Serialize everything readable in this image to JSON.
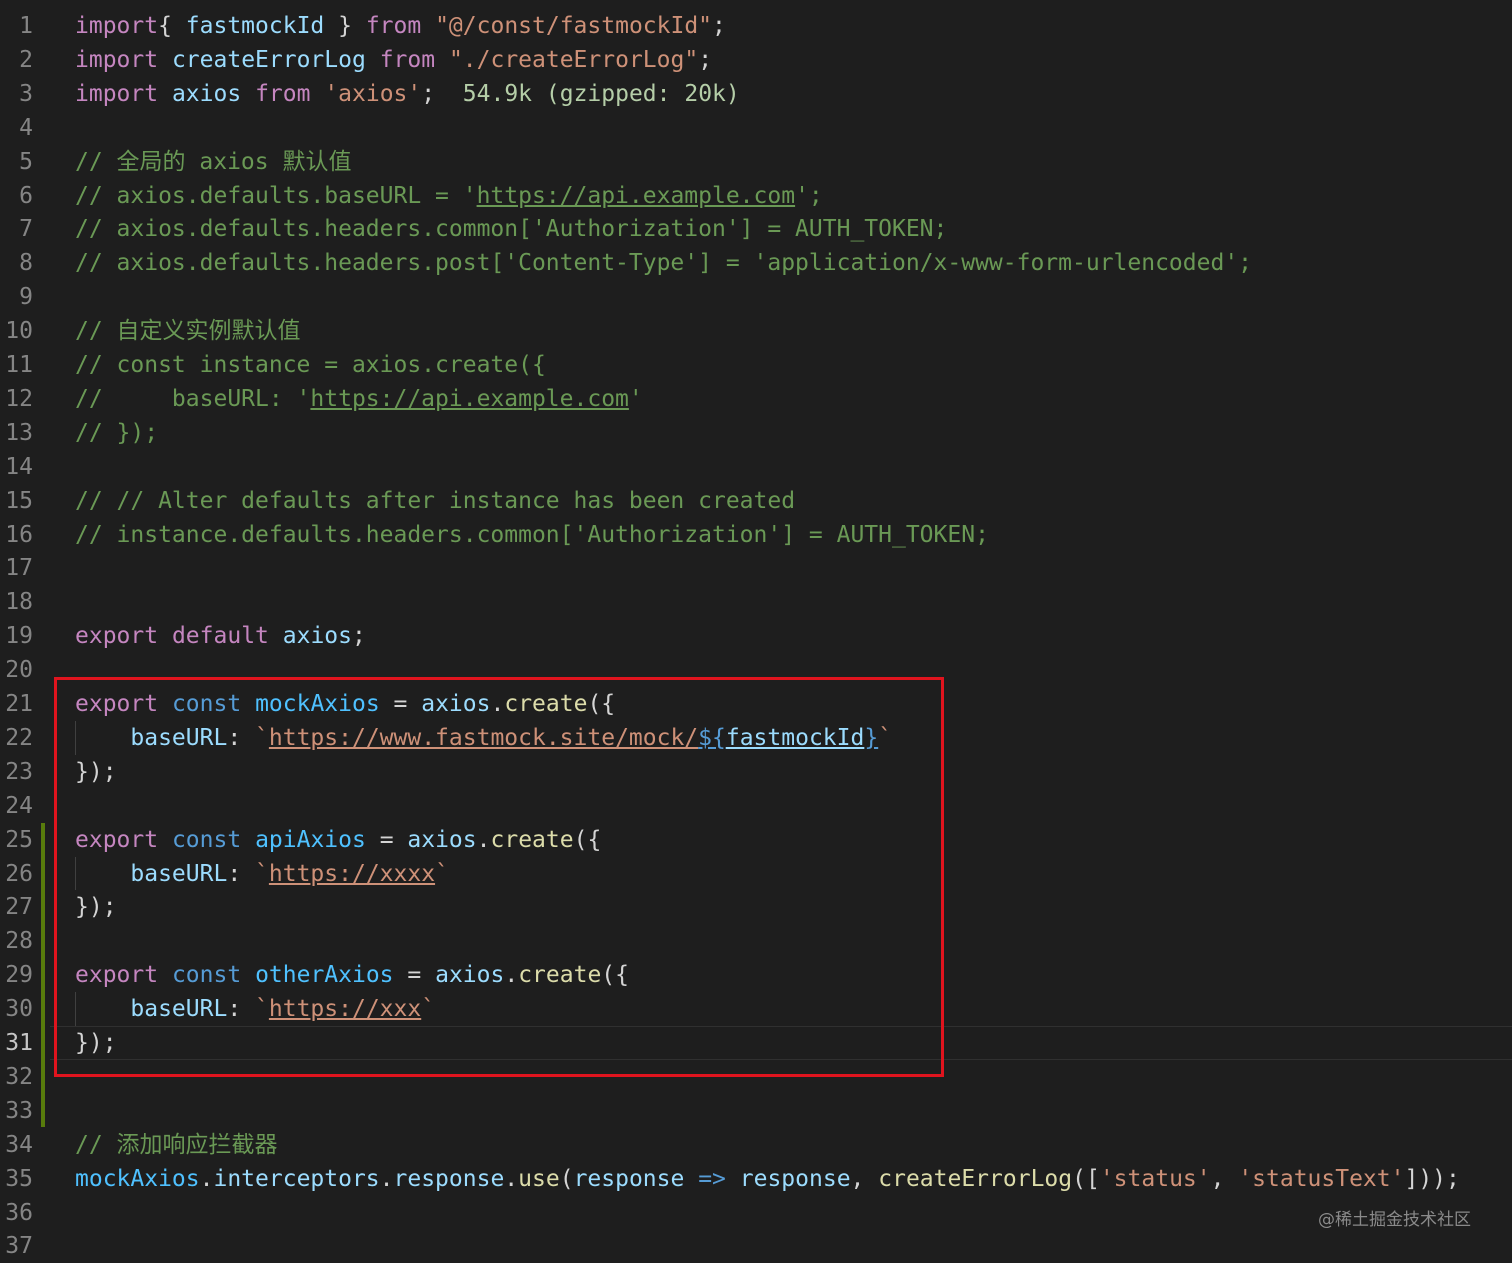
{
  "editor": {
    "active_line": "31",
    "lines": [
      {
        "n": "1",
        "tokens": [
          [
            "kw",
            "import"
          ],
          [
            "",
            "{ "
          ],
          [
            "var",
            "fastmockId"
          ],
          [
            "",
            " } "
          ],
          [
            "kw",
            "from"
          ],
          [
            "",
            " "
          ],
          [
            "str",
            "\"@/const/fastmockId\""
          ],
          [
            "",
            ";"
          ]
        ]
      },
      {
        "n": "2",
        "tokens": [
          [
            "kw",
            "import"
          ],
          [
            "",
            " "
          ],
          [
            "var",
            "createErrorLog"
          ],
          [
            "",
            " "
          ],
          [
            "kw",
            "from"
          ],
          [
            "",
            " "
          ],
          [
            "str",
            "\"./createErrorLog\""
          ],
          [
            "",
            ";"
          ]
        ]
      },
      {
        "n": "3",
        "tokens": [
          [
            "kw",
            "import"
          ],
          [
            "",
            " "
          ],
          [
            "var",
            "axios"
          ],
          [
            "",
            " "
          ],
          [
            "kw",
            "from"
          ],
          [
            "",
            " "
          ],
          [
            "str",
            "'axios'"
          ],
          [
            "",
            ";  "
          ],
          [
            "sz",
            "54.9k (gzipped: 20k)"
          ]
        ]
      },
      {
        "n": "4",
        "tokens": []
      },
      {
        "n": "5",
        "tokens": [
          [
            "cm",
            "// 全局的 axios 默认值"
          ]
        ]
      },
      {
        "n": "6",
        "tokens": [
          [
            "cm",
            "// axios.defaults.baseURL = '"
          ],
          [
            "cm ul",
            "https://api.example.com"
          ],
          [
            "cm",
            "';"
          ]
        ]
      },
      {
        "n": "7",
        "tokens": [
          [
            "cm",
            "// axios.defaults.headers.common['Authorization'] = AUTH_TOKEN;"
          ]
        ]
      },
      {
        "n": "8",
        "tokens": [
          [
            "cm",
            "// axios.defaults.headers.post['Content-Type'] = 'application/x-www-form-urlencoded';"
          ]
        ]
      },
      {
        "n": "9",
        "tokens": []
      },
      {
        "n": "10",
        "tokens": [
          [
            "cm",
            "// 自定义实例默认值"
          ]
        ]
      },
      {
        "n": "11",
        "tokens": [
          [
            "cm",
            "// const instance = axios.create({"
          ]
        ]
      },
      {
        "n": "12",
        "tokens": [
          [
            "cm",
            "//     baseURL: '"
          ],
          [
            "cm ul",
            "https://api.example.com"
          ],
          [
            "cm",
            "'"
          ]
        ]
      },
      {
        "n": "13",
        "tokens": [
          [
            "cm",
            "// });"
          ]
        ]
      },
      {
        "n": "14",
        "tokens": []
      },
      {
        "n": "15",
        "tokens": [
          [
            "cm",
            "// // Alter defaults after instance has been created"
          ]
        ]
      },
      {
        "n": "16",
        "tokens": [
          [
            "cm",
            "// instance.defaults.headers.common['Authorization'] = AUTH_TOKEN;"
          ]
        ]
      },
      {
        "n": "17",
        "tokens": []
      },
      {
        "n": "18",
        "tokens": []
      },
      {
        "n": "19",
        "tokens": [
          [
            "kw",
            "export"
          ],
          [
            "",
            " "
          ],
          [
            "kw",
            "default"
          ],
          [
            "",
            " "
          ],
          [
            "var",
            "axios"
          ],
          [
            "",
            ";"
          ]
        ]
      },
      {
        "n": "20",
        "tokens": []
      },
      {
        "n": "21",
        "tokens": [
          [
            "kw",
            "export"
          ],
          [
            "",
            " "
          ],
          [
            "st",
            "const"
          ],
          [
            "",
            " "
          ],
          [
            "cst",
            "mockAxios"
          ],
          [
            "",
            " = "
          ],
          [
            "var",
            "axios"
          ],
          [
            "",
            "."
          ],
          [
            "fn",
            "create"
          ],
          [
            "",
            "({"
          ]
        ]
      },
      {
        "n": "22",
        "tokens": [
          [
            "",
            "    "
          ],
          [
            "prop",
            "baseURL"
          ],
          [
            "",
            ": "
          ],
          [
            "str",
            "`"
          ],
          [
            "str ul",
            "https://www.fastmock.site/mock/"
          ],
          [
            "tpl ul",
            "${"
          ],
          [
            "var ul",
            "fastmockId"
          ],
          [
            "tpl ul",
            "}"
          ],
          [
            "str",
            "`"
          ]
        ]
      },
      {
        "n": "23",
        "tokens": [
          [
            "",
            "});"
          ]
        ]
      },
      {
        "n": "24",
        "tokens": []
      },
      {
        "n": "25",
        "tokens": [
          [
            "kw",
            "export"
          ],
          [
            "",
            " "
          ],
          [
            "st",
            "const"
          ],
          [
            "",
            " "
          ],
          [
            "cst",
            "apiAxios"
          ],
          [
            "",
            " = "
          ],
          [
            "var",
            "axios"
          ],
          [
            "",
            "."
          ],
          [
            "fn",
            "create"
          ],
          [
            "",
            "({"
          ]
        ]
      },
      {
        "n": "26",
        "tokens": [
          [
            "",
            "    "
          ],
          [
            "prop",
            "baseURL"
          ],
          [
            "",
            ": "
          ],
          [
            "str",
            "`"
          ],
          [
            "str ul",
            "https://xxxx"
          ],
          [
            "str",
            "`"
          ]
        ]
      },
      {
        "n": "27",
        "tokens": [
          [
            "",
            "});"
          ]
        ]
      },
      {
        "n": "28",
        "tokens": []
      },
      {
        "n": "29",
        "tokens": [
          [
            "kw",
            "export"
          ],
          [
            "",
            " "
          ],
          [
            "st",
            "const"
          ],
          [
            "",
            " "
          ],
          [
            "cst",
            "otherAxios"
          ],
          [
            "",
            " = "
          ],
          [
            "var",
            "axios"
          ],
          [
            "",
            "."
          ],
          [
            "fn",
            "create"
          ],
          [
            "",
            "({"
          ]
        ]
      },
      {
        "n": "30",
        "tokens": [
          [
            "",
            "    "
          ],
          [
            "prop",
            "baseURL"
          ],
          [
            "",
            ": "
          ],
          [
            "str",
            "`"
          ],
          [
            "str ul",
            "https://xxx"
          ],
          [
            "str",
            "`"
          ]
        ]
      },
      {
        "n": "31",
        "tokens": [
          [
            "",
            "});"
          ]
        ]
      },
      {
        "n": "32",
        "tokens": []
      },
      {
        "n": "33",
        "tokens": []
      },
      {
        "n": "34",
        "tokens": [
          [
            "cm",
            "// 添加响应拦截器"
          ]
        ]
      },
      {
        "n": "35",
        "tokens": [
          [
            "cst",
            "mockAxios"
          ],
          [
            "",
            "."
          ],
          [
            "var",
            "interceptors"
          ],
          [
            "",
            "."
          ],
          [
            "var",
            "response"
          ],
          [
            "",
            "."
          ],
          [
            "fn",
            "use"
          ],
          [
            "",
            "("
          ],
          [
            "var",
            "response"
          ],
          [
            "",
            " "
          ],
          [
            "st",
            "=>"
          ],
          [
            "",
            " "
          ],
          [
            "var",
            "response"
          ],
          [
            "",
            ", "
          ],
          [
            "fn",
            "createErrorLog"
          ],
          [
            "",
            "(["
          ],
          [
            "str",
            "'status'"
          ],
          [
            "",
            ", "
          ],
          [
            "str",
            "'statusText'"
          ],
          [
            "",
            "]));"
          ]
        ]
      },
      {
        "n": "36",
        "tokens": []
      },
      {
        "n": "37",
        "tokens": []
      }
    ]
  },
  "watermark": "@稀土掘金技术社区",
  "colors": {
    "background": "#1e1e1e",
    "highlight_box": "#e0141e",
    "git_added": "#587c0c"
  }
}
